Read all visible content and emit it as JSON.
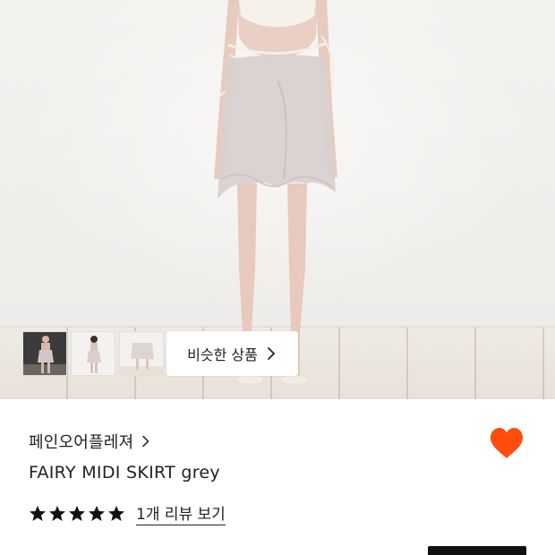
{
  "gallery": {
    "similar_button_label": "비슷한 상품",
    "similar_icon": "chevron-right-icon",
    "thumbnails": [
      {
        "alt": "thumbnail-1"
      },
      {
        "alt": "thumbnail-2"
      },
      {
        "alt": "thumbnail-3"
      }
    ]
  },
  "product": {
    "brand": "페인오어플레져",
    "brand_icon": "chevron-right-icon",
    "name": "FAIRY MIDI SKIRT grey",
    "rating_stars": 5,
    "review_link": "1개 리뷰 보기",
    "wishlisted": true,
    "wishlist_icon": "heart-icon"
  },
  "colors": {
    "accent": "#ff4d0d",
    "text": "#222222",
    "star": "#111111"
  }
}
